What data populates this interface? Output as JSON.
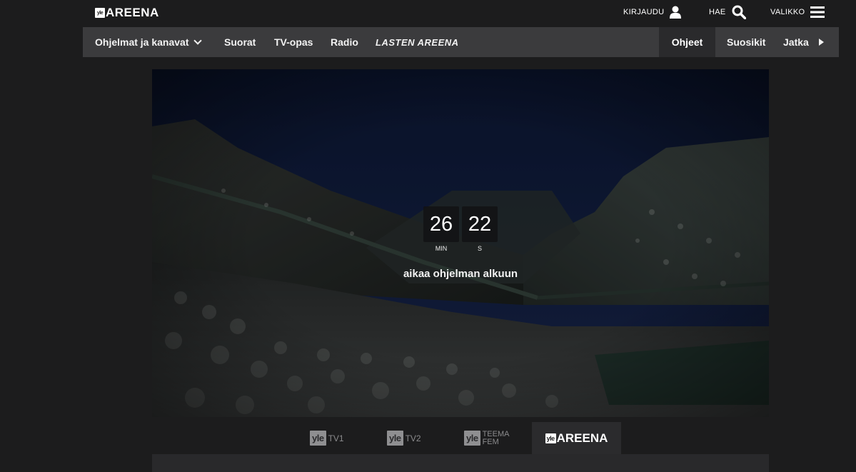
{
  "header": {
    "logo_badge": "yle",
    "logo_text": "AREENA",
    "login_label": "KIRJAUDU",
    "search_label": "HAE",
    "menu_label": "VALIKKO"
  },
  "nav": {
    "programs": "Ohjelmat ja kanavat",
    "live": "Suorat",
    "tvguide": "TV-opas",
    "radio": "Radio",
    "kids": "LASTEN AREENA",
    "help": "Ohjeet",
    "favorites": "Suosikit",
    "continue": "Jatka"
  },
  "countdown": {
    "minutes": "26",
    "seconds": "22",
    "min_label": "MIN",
    "sec_label": "S",
    "caption": "aikaa ohjelman alkuun"
  },
  "channels": {
    "tv1_badge": "yle",
    "tv1_name": "TV1",
    "tv2_badge": "yle",
    "tv2_name": "TV2",
    "teema_badge": "yle",
    "teema_line1": "TEEMA",
    "teema_line2": "FEM",
    "areena_badge": "yle",
    "areena_name": "AREENA"
  },
  "colors": {
    "background": "#1c1c1d",
    "navbar": "#3b3b3d",
    "active_tab": "#2a2a2c"
  }
}
